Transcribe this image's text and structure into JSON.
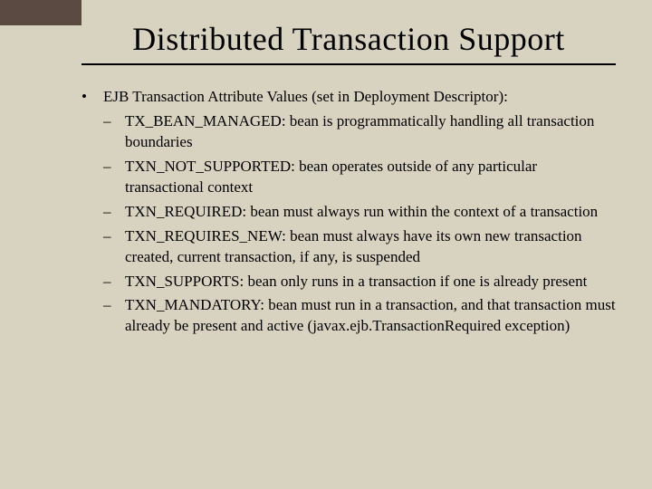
{
  "title": "Distributed Transaction Support",
  "main": {
    "heading": "EJB Transaction Attribute Values (set in Deployment Descriptor):",
    "items": [
      "TX_BEAN_MANAGED: bean is programmatically handling all transaction boundaries",
      "TXN_NOT_SUPPORTED: bean operates outside of any particular transactional context",
      "TXN_REQUIRED: bean must always run within the context of a transaction",
      "TXN_REQUIRES_NEW: bean must always have its own new transaction created, current transaction, if any, is suspended",
      "TXN_SUPPORTS: bean only runs in a transaction if one is already present",
      "TXN_MANDATORY: bean must run in a transaction, and that transaction must already be present and active (javax.ejb.TransactionRequired exception)"
    ]
  }
}
